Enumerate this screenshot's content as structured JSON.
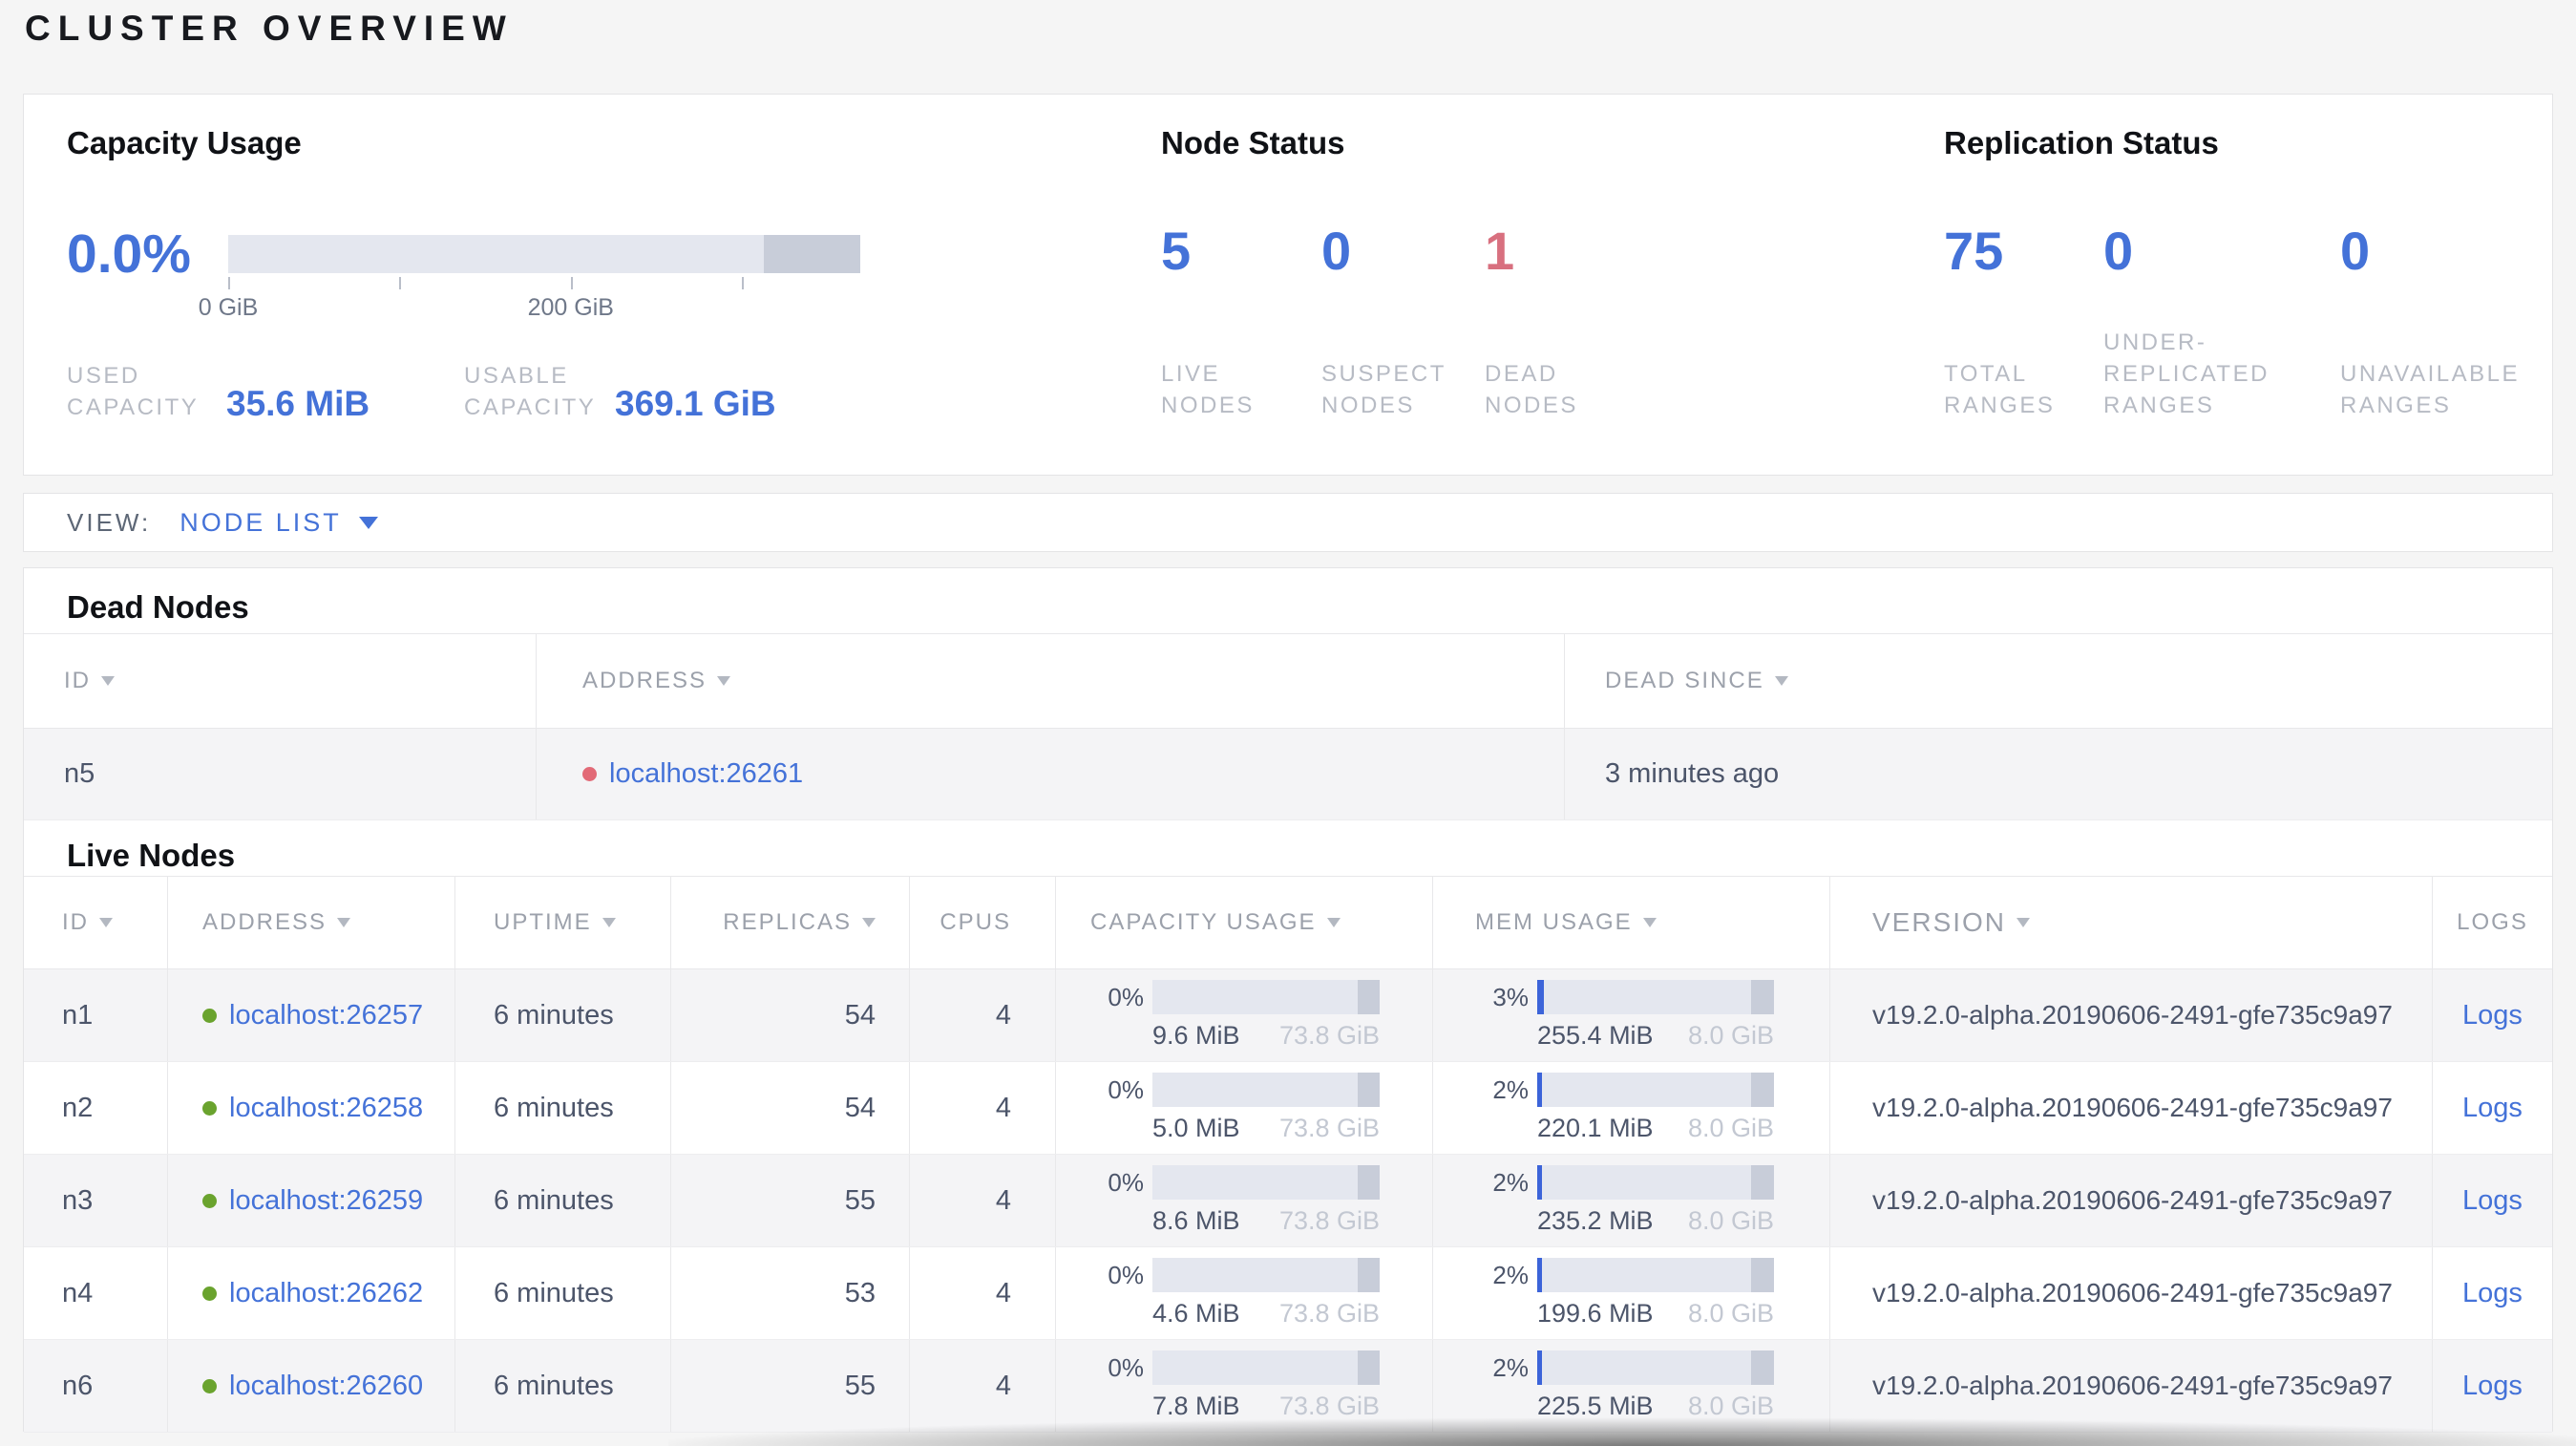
{
  "page": {
    "title": "CLUSTER OVERVIEW"
  },
  "colors": {
    "accent_blue": "#4472d8",
    "alert_red": "#d8707f",
    "live_green": "#6aa32e",
    "dead_red": "#e26a77",
    "bar_track": "#e4e7ef",
    "bar_dark": "#c8cdd9",
    "bar_fill": "#3c64d9"
  },
  "summary": {
    "capacity": {
      "title": "Capacity Usage",
      "percent": "0.0%",
      "bar": {
        "fill_pct": 0,
        "dark_pct": 15.2,
        "ticks": [
          {
            "label": "0 GiB",
            "pct": 0
          },
          {
            "label": "",
            "pct": 27.1
          },
          {
            "label": "200 GiB",
            "pct": 54.2
          },
          {
            "label": "",
            "pct": 81.3
          }
        ]
      },
      "stats": [
        {
          "label": "USED\nCAPACITY",
          "value": "35.6 MiB"
        },
        {
          "label": "USABLE\nCAPACITY",
          "value": "369.1 GiB"
        }
      ]
    },
    "node_status": {
      "title": "Node Status",
      "stats": [
        {
          "value": "5",
          "label": "LIVE\nNODES"
        },
        {
          "value": "0",
          "label": "SUSPECT\nNODES"
        },
        {
          "value": "1",
          "label": "DEAD\nNODES"
        }
      ]
    },
    "replication": {
      "title": "Replication Status",
      "stats": [
        {
          "value": "75",
          "label": "TOTAL\nRANGES"
        },
        {
          "value": "0",
          "label": "UNDER-\nREPLICATED\nRANGES"
        },
        {
          "value": "0",
          "label": "UNAVAILABLE\nRANGES"
        }
      ]
    }
  },
  "view_bar": {
    "label": "VIEW:",
    "selected": "NODE LIST"
  },
  "dead_nodes": {
    "title": "Dead Nodes",
    "headers": [
      "ID",
      "ADDRESS",
      "DEAD SINCE"
    ],
    "rows": [
      {
        "id": "n5",
        "address": "localhost:26261",
        "dead_since": "3 minutes ago"
      }
    ]
  },
  "live_nodes": {
    "title": "Live Nodes",
    "headers": [
      "ID",
      "ADDRESS",
      "UPTIME",
      "REPLICAS",
      "CPUS",
      "CAPACITY USAGE",
      "MEM USAGE",
      "VERSION",
      "LOGS"
    ],
    "bar_dark_pct": 9.6,
    "logs_label": "Logs",
    "rows": [
      {
        "id": "n1",
        "address": "localhost:26257",
        "uptime": "6 minutes",
        "replicas": "54",
        "cpus": "4",
        "capacity": {
          "pct": "0%",
          "pct_num": 0,
          "used": "9.6 MiB",
          "total": "73.8 GiB"
        },
        "mem": {
          "pct": "3%",
          "pct_num": 3,
          "used": "255.4 MiB",
          "total": "8.0 GiB"
        },
        "version": "v19.2.0-alpha.20190606-2491-gfe735c9a97"
      },
      {
        "id": "n2",
        "address": "localhost:26258",
        "uptime": "6 minutes",
        "replicas": "54",
        "cpus": "4",
        "capacity": {
          "pct": "0%",
          "pct_num": 0,
          "used": "5.0 MiB",
          "total": "73.8 GiB"
        },
        "mem": {
          "pct": "2%",
          "pct_num": 2,
          "used": "220.1 MiB",
          "total": "8.0 GiB"
        },
        "version": "v19.2.0-alpha.20190606-2491-gfe735c9a97"
      },
      {
        "id": "n3",
        "address": "localhost:26259",
        "uptime": "6 minutes",
        "replicas": "55",
        "cpus": "4",
        "capacity": {
          "pct": "0%",
          "pct_num": 0,
          "used": "8.6 MiB",
          "total": "73.8 GiB"
        },
        "mem": {
          "pct": "2%",
          "pct_num": 2,
          "used": "235.2 MiB",
          "total": "8.0 GiB"
        },
        "version": "v19.2.0-alpha.20190606-2491-gfe735c9a97"
      },
      {
        "id": "n4",
        "address": "localhost:26262",
        "uptime": "6 minutes",
        "replicas": "53",
        "cpus": "4",
        "capacity": {
          "pct": "0%",
          "pct_num": 0,
          "used": "4.6 MiB",
          "total": "73.8 GiB"
        },
        "mem": {
          "pct": "2%",
          "pct_num": 2,
          "used": "199.6 MiB",
          "total": "8.0 GiB"
        },
        "version": "v19.2.0-alpha.20190606-2491-gfe735c9a97"
      },
      {
        "id": "n6",
        "address": "localhost:26260",
        "uptime": "6 minutes",
        "replicas": "55",
        "cpus": "4",
        "capacity": {
          "pct": "0%",
          "pct_num": 0,
          "used": "7.8 MiB",
          "total": "73.8 GiB"
        },
        "mem": {
          "pct": "2%",
          "pct_num": 2,
          "used": "225.5 MiB",
          "total": "8.0 GiB"
        },
        "version": "v19.2.0-alpha.20190606-2491-gfe735c9a97"
      }
    ]
  }
}
